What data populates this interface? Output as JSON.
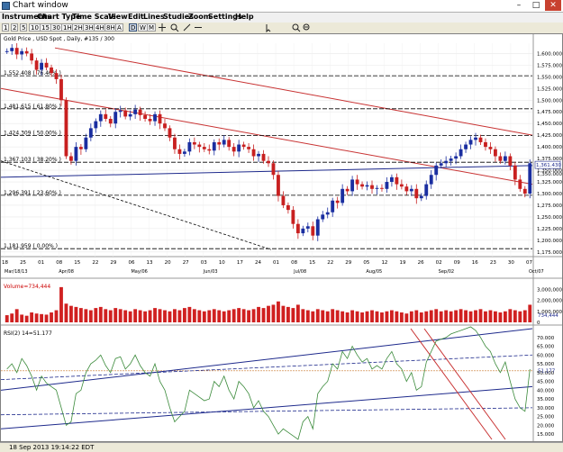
{
  "window": {
    "title": "Chart window",
    "minimize": "–",
    "maximize": "□",
    "close": "✕"
  },
  "menu": [
    "Instruments",
    "Chart Type",
    "Time Scale",
    "View",
    "Edit",
    "Lines",
    "Studies",
    "Zoom",
    "Settings",
    "Help"
  ],
  "toolbar": {
    "buttons": [
      "1",
      "2",
      "5",
      "10",
      "15",
      "30",
      "1H",
      "2H",
      "3H",
      "4H",
      "8H",
      "D",
      "W",
      "M",
      "A"
    ],
    "selected": "D",
    "icon_names": [
      "crosshair-icon",
      "zoom-in-icon",
      "zoom-out-icon",
      "draw-line-icon",
      "horizontal-line-icon",
      "cursor-icon",
      "search-icon",
      "zoom-icon"
    ]
  },
  "chart_data": {
    "type": "candlestick",
    "title": "Gold Price , USD Spot , Daily, #135 / 300",
    "price_axis": {
      "ticks": [
        1175,
        1200,
        1225,
        1250,
        1275,
        1300,
        1325,
        1350,
        1375,
        1400,
        1425,
        1450,
        1475,
        1500,
        1525,
        1550,
        1575,
        1600
      ],
      "range": [
        1165,
        1622
      ]
    },
    "time_axis_top": [
      "18",
      "25",
      "01",
      "08",
      "15",
      "22",
      "29",
      "06",
      "13",
      "20",
      "27",
      "03",
      "10",
      "17",
      "24",
      "01",
      "08",
      "15",
      "22",
      "29",
      "05",
      "12",
      "19",
      "26",
      "02",
      "09",
      "16",
      "23",
      "30",
      "07"
    ],
    "time_axis_months": [
      "Mar/18/13",
      "Apr/08",
      "May/06",
      "Jun/03",
      "Jul/08",
      "Aug/05",
      "Sep/02",
      "Oct/07"
    ],
    "fib_levels": [
      {
        "value": 1552.408,
        "label": "1,552.408 ( 76.40% )"
      },
      {
        "value": 1481.615,
        "label": "1,481.615 ( 61.80% )"
      },
      {
        "value": 1424.309,
        "label": "1,424.309 ( 50.00% )"
      },
      {
        "value": 1367.103,
        "label": "1,367.103 ( 38.20% )"
      },
      {
        "value": 1296.391,
        "label": "1,296.391 ( 23.60% )"
      },
      {
        "value": 1181.959,
        "label": "1,181.959 ( 0.00% )"
      }
    ],
    "last_price": "1,361.430",
    "price_tag_2": "1,350.000",
    "closes": [
      1605,
      1612,
      1598,
      1605,
      1600,
      1585,
      1565,
      1580,
      1570,
      1558,
      1545,
      1500,
      1380,
      1370,
      1400,
      1395,
      1420,
      1440,
      1455,
      1470,
      1460,
      1450,
      1475,
      1478,
      1465,
      1470,
      1480,
      1468,
      1460,
      1455,
      1470,
      1450,
      1440,
      1420,
      1395,
      1385,
      1390,
      1410,
      1405,
      1400,
      1395,
      1392,
      1410,
      1405,
      1415,
      1400,
      1390,
      1405,
      1400,
      1395,
      1380,
      1385,
      1370,
      1365,
      1340,
      1295,
      1275,
      1265,
      1235,
      1215,
      1225,
      1230,
      1210,
      1245,
      1255,
      1260,
      1285,
      1280,
      1310,
      1305,
      1330,
      1320,
      1315,
      1318,
      1310,
      1312,
      1310,
      1325,
      1335,
      1320,
      1315,
      1305,
      1310,
      1290,
      1295,
      1320,
      1340,
      1360,
      1365,
      1370,
      1375,
      1380,
      1395,
      1405,
      1415,
      1420,
      1410,
      1400,
      1395,
      1380,
      1370,
      1380,
      1360,
      1330,
      1310,
      1300,
      1365
    ],
    "volume": {
      "label": "Volume=734,444",
      "ticks": [
        "3,000,000",
        "2,000,000",
        "1,000,000",
        "0"
      ],
      "last_tag": "734,444",
      "values": [
        0.65,
        0.8,
        1.2,
        0.7,
        0.6,
        0.9,
        0.8,
        0.75,
        0.7,
        0.9,
        1.1,
        3.2,
        1.7,
        1.5,
        1.4,
        1.3,
        1.2,
        1.1,
        1.3,
        1.4,
        1.2,
        1.1,
        1.3,
        1.2,
        1.1,
        1.0,
        1.2,
        1.1,
        1.0,
        1.1,
        1.3,
        1.2,
        1.1,
        1.0,
        1.2,
        1.1,
        1.3,
        1.4,
        1.2,
        1.1,
        1.0,
        1.1,
        1.2,
        1.1,
        1.0,
        1.1,
        1.2,
        1.3,
        1.2,
        1.1,
        1.2,
        1.4,
        1.3,
        1.5,
        1.6,
        1.9,
        1.5,
        1.4,
        1.3,
        1.6,
        1.2,
        1.1,
        1.0,
        1.2,
        1.1,
        1.0,
        1.2,
        1.1,
        1.0,
        0.9,
        1.1,
        1.0,
        0.9,
        1.0,
        1.1,
        1.0,
        0.9,
        1.0,
        1.1,
        1.0,
        0.9,
        0.8,
        1.0,
        1.1,
        0.9,
        1.0,
        1.1,
        1.2,
        1.0,
        1.1,
        1.0,
        1.1,
        1.2,
        1.1,
        1.0,
        1.1,
        1.2,
        1.0,
        1.1,
        1.0,
        0.9,
        1.0,
        1.2,
        1.1,
        1.0,
        1.1,
        1.6
      ]
    },
    "rsi": {
      "label": "RSI(2) 14=51.177",
      "ticks": [
        15,
        20,
        25,
        30,
        35,
        40,
        45,
        50,
        55,
        60,
        65,
        70
      ],
      "last_tag": "51.177",
      "values": [
        52,
        55,
        50,
        58,
        54,
        48,
        40,
        48,
        44,
        42,
        40,
        30,
        20,
        22,
        38,
        40,
        50,
        55,
        57,
        60,
        54,
        50,
        58,
        59,
        52,
        55,
        60,
        54,
        50,
        48,
        55,
        45,
        40,
        30,
        22,
        25,
        28,
        40,
        38,
        36,
        34,
        35,
        45,
        42,
        48,
        40,
        35,
        45,
        42,
        38,
        30,
        34,
        28,
        25,
        20,
        15,
        18,
        16,
        14,
        12,
        22,
        25,
        18,
        38,
        42,
        45,
        55,
        52,
        62,
        58,
        65,
        60,
        56,
        58,
        52,
        54,
        52,
        58,
        62,
        55,
        52,
        45,
        50,
        40,
        42,
        56,
        62,
        68,
        69,
        70,
        72,
        73,
        74,
        75,
        76,
        74,
        70,
        65,
        62,
        55,
        50,
        56,
        45,
        35,
        30,
        28,
        52
      ]
    }
  },
  "status": {
    "datetime": "18 Sep 2013 19:14:22 EDT"
  }
}
